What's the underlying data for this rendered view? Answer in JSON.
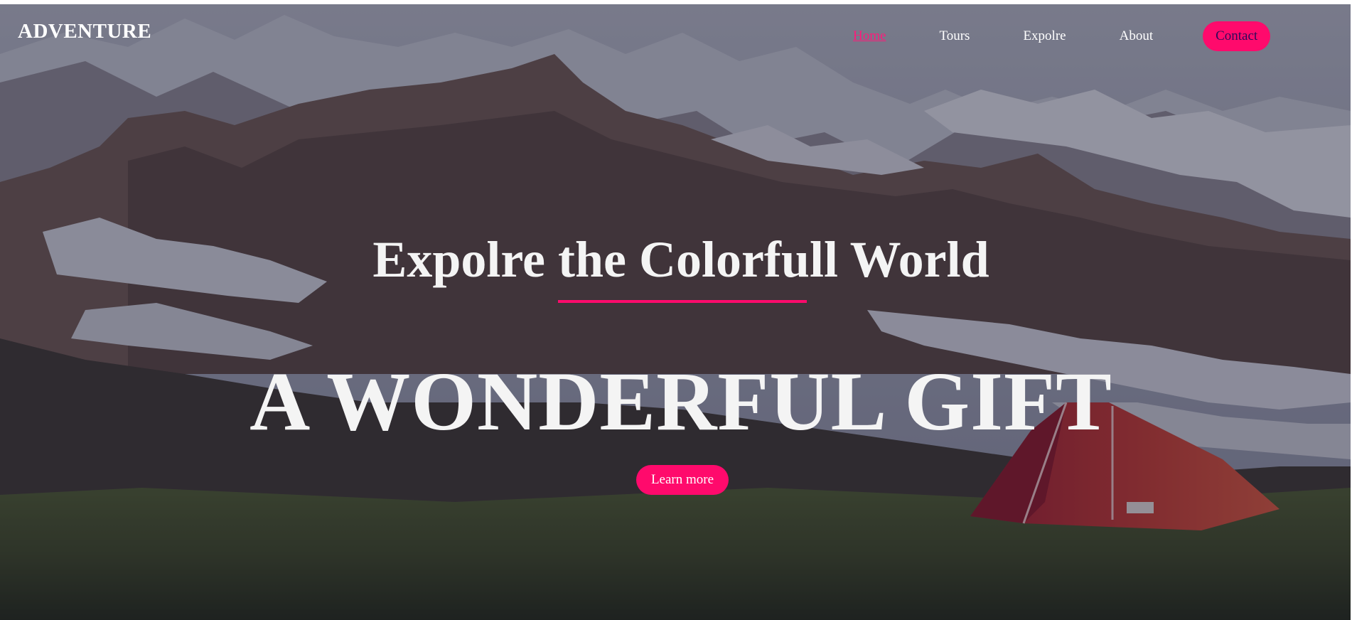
{
  "header": {
    "logo": "ADVENTURE",
    "nav": {
      "home": "Home",
      "tours": "Tours",
      "explore": "Expolre",
      "about": "About",
      "contact": "Contact"
    }
  },
  "hero": {
    "headline": "Expolre the Colorfull World",
    "title": "A WONDERFUL GIFT",
    "cta_label": "Learn more"
  },
  "colors": {
    "accent": "#ff0a6c",
    "text": "#ffffff",
    "overlay": "#201e34"
  },
  "background_image": "mountain-camp-landscape"
}
